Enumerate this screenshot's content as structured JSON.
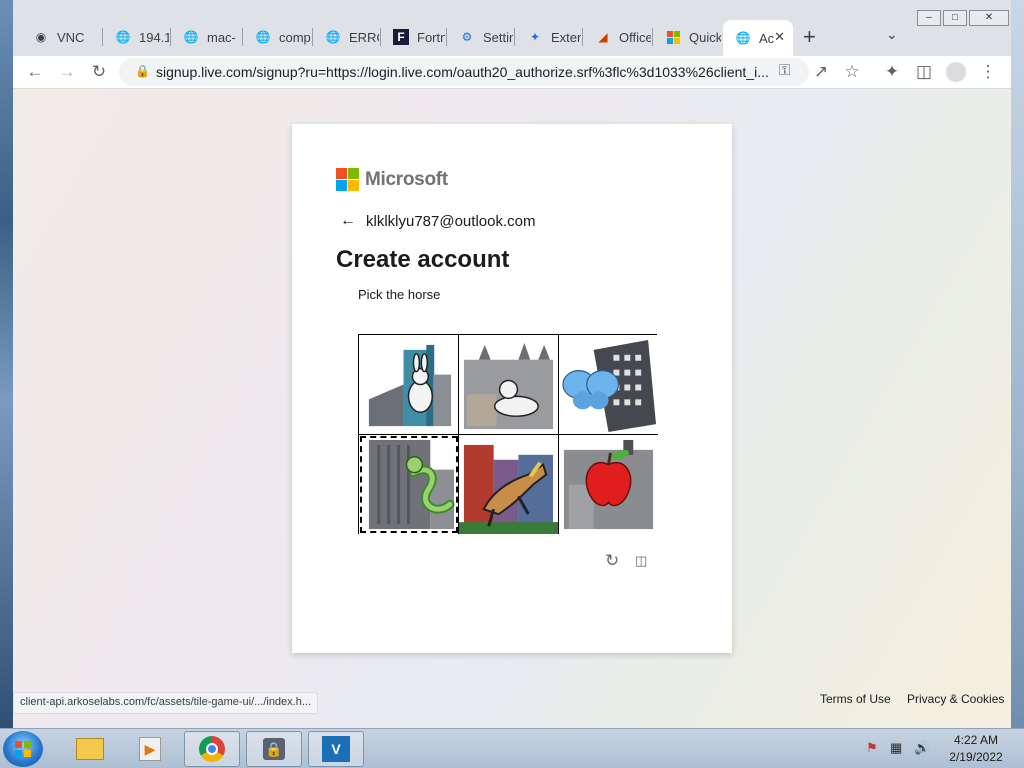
{
  "browser": {
    "tabs": [
      {
        "label": "VNC",
        "icon": "vnc-icon"
      },
      {
        "label": "194.1",
        "icon": "globe-icon"
      },
      {
        "label": "mac-",
        "icon": "globe-icon"
      },
      {
        "label": "comp",
        "icon": "globe-icon"
      },
      {
        "label": "ERRO",
        "icon": "globe-icon"
      },
      {
        "label": "Fortn",
        "icon": "fortnite-icon"
      },
      {
        "label": "Settin",
        "icon": "gear-icon"
      },
      {
        "label": "Exten",
        "icon": "puzzle-icon"
      },
      {
        "label": "Office",
        "icon": "office-icon"
      },
      {
        "label": "Quick",
        "icon": "microsoft-icon"
      },
      {
        "label": "Ac",
        "icon": "globe-icon",
        "active": true
      }
    ],
    "url": "signup.live.com/signup?ru=https://login.live.com/oauth20_authorize.srf%3flc%3d1033%26client_i...",
    "status_url": "client-api.arkoselabs.com/fc/assets/tile-game-ui/.../index.h..."
  },
  "card": {
    "brand": "Microsoft",
    "identity": "klklklyu787@outlook.com",
    "title": "Create account",
    "prompt": "Pick the horse",
    "tiles": [
      {
        "subject": "rabbit"
      },
      {
        "subject": "seal"
      },
      {
        "subject": "butterfly"
      },
      {
        "subject": "snake"
      },
      {
        "subject": "horse"
      },
      {
        "subject": "apple"
      }
    ]
  },
  "footer": {
    "terms": "Terms of Use",
    "privacy": "Privacy & Cookies"
  },
  "taskbar": {
    "time": "4:22 AM",
    "date": "2/19/2022"
  },
  "colors": {
    "ms_red": "#f25022",
    "ms_green": "#7fba00",
    "ms_blue": "#00a4ef",
    "ms_yellow": "#ffb900"
  }
}
